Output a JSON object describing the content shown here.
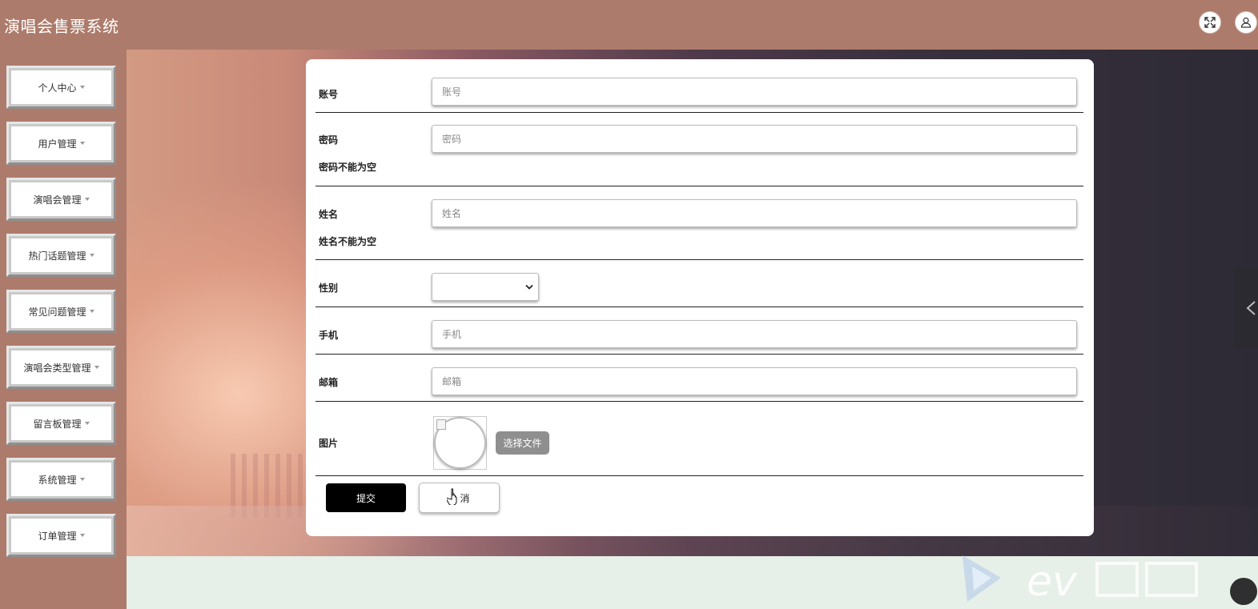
{
  "app": {
    "title": "演唱会售票系统"
  },
  "header": {
    "fullscreen_icon": "expand-icon",
    "user_icon": "user-icon"
  },
  "sidebar": {
    "items": [
      {
        "label": "个人中心"
      },
      {
        "label": "用户管理"
      },
      {
        "label": "演唱会管理"
      },
      {
        "label": "热门话题管理"
      },
      {
        "label": "常见问题管理"
      },
      {
        "label": "演唱会类型管理"
      },
      {
        "label": "留言板管理"
      },
      {
        "label": "系统管理"
      },
      {
        "label": "订单管理"
      }
    ]
  },
  "form": {
    "account": {
      "label": "账号",
      "placeholder": "账号",
      "value": ""
    },
    "password": {
      "label": "密码",
      "placeholder": "密码",
      "value": "",
      "error": "密码不能为空"
    },
    "name": {
      "label": "姓名",
      "placeholder": "姓名",
      "value": "",
      "error": "姓名不能为空"
    },
    "gender": {
      "label": "性别",
      "selected": ""
    },
    "phone": {
      "label": "手机",
      "placeholder": "手机",
      "value": ""
    },
    "email": {
      "label": "邮箱",
      "placeholder": "邮箱",
      "value": ""
    },
    "image": {
      "label": "图片",
      "choose_file": "选择文件"
    },
    "submit_label": "提交",
    "cancel_label": "消"
  },
  "colors": {
    "header_bg": "#ad7b6b",
    "sidebar_bg": "#ad7b6b",
    "submit_bg": "#000000",
    "file_btn_bg": "#8f8f8f"
  }
}
